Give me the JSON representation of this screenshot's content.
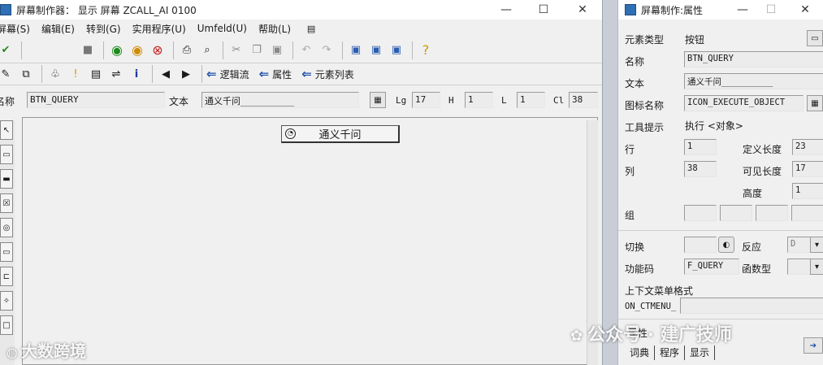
{
  "main_window": {
    "title": "屏幕制作器： 显示 屏幕 ZCALL_AI 0100",
    "menu": [
      "屏幕(S)",
      "编辑(E)",
      "转到(G)",
      "实用程序(U)",
      "Umfeld(U)",
      "帮助(L)"
    ],
    "toolbar2_text_buttons": [
      "逻辑流",
      "属性",
      "元素列表"
    ],
    "attr_row": {
      "name_label": "名称",
      "name_value": "BTN_QUERY",
      "text_label": "文本",
      "text_value": "通义千问__________",
      "lg_label": "Lg",
      "lg_value": "17",
      "h_label": "H",
      "h_value": "1",
      "l_label": "L",
      "l_value": "1",
      "cl_label": "Cl",
      "cl_value": "38"
    },
    "canvas_button_label": "通义千问"
  },
  "attr_window": {
    "title": "屏幕制作:属性",
    "element_type_label": "元素类型",
    "element_type_value": "按钮",
    "name_label": "名称",
    "name_value": "BTN_QUERY",
    "text_label": "文本",
    "text_value": "通义千问__________",
    "icon_label": "图标名称",
    "icon_value": "ICON_EXECUTE_OBJECT",
    "tooltip_label": "工具提示",
    "tooltip_value": "执行 <对象>",
    "row_label": "行",
    "row_value": "1",
    "col_label": "列",
    "col_value": "38",
    "deflen_label": "定义长度",
    "deflen_value": "23",
    "vislen_label": "可见长度",
    "vislen_value": "17",
    "height_label": "高度",
    "height_value": "1",
    "group_label": "组",
    "switch_label": "切换",
    "react_label": "反应",
    "react_value": "D",
    "fcode_label": "功能码",
    "fcode_value": "F_QUERY",
    "ftype_label": "函数型",
    "ctx_label": "上下文菜单格式",
    "ctx_value": "ON_CTMENU_",
    "props_label": "属性",
    "tabs": [
      "词典",
      "程序",
      "显示"
    ]
  },
  "overlay": {
    "left_text": "大数跨境",
    "right_text": "公众号 · 建广技师"
  },
  "icons": [
    "check-icon",
    "save-icon",
    "back-icon",
    "exit-icon",
    "cancel-icon",
    "print-icon",
    "find-icon",
    "cut-icon",
    "copy-icon",
    "paste-icon",
    "undo-icon",
    "redo-icon",
    "layout-icon",
    "help-icon",
    "execute-icon"
  ]
}
